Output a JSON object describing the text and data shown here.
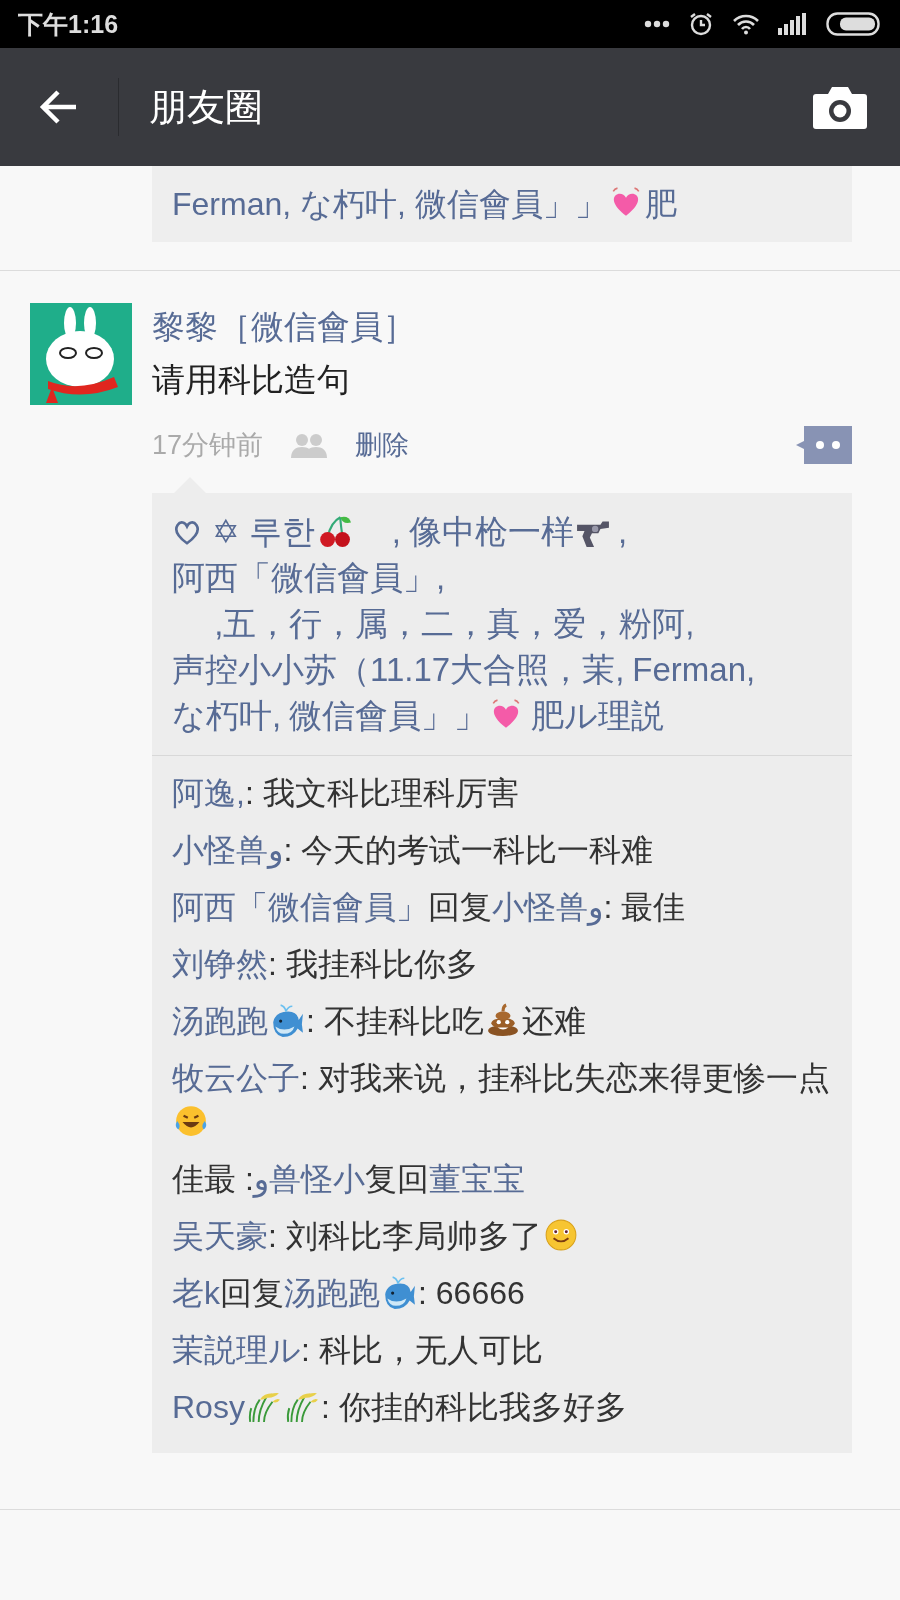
{
  "status_bar": {
    "time": "下午1:16"
  },
  "header": {
    "title": "朋友圈"
  },
  "previous_post": {
    "likes": [
      {
        "kind": "name",
        "text": "Ferman, な朽叶, 微信會員」」"
      },
      {
        "kind": "heart"
      },
      {
        "kind": "name",
        "text": "肥"
      }
    ]
  },
  "post": {
    "author": "黎黎［微信會員］",
    "text": "请用科比造句",
    "time": "17分钟前",
    "delete_label": "删除",
    "likes": [
      {
        "kind": "name",
        "text": "✡ 루한"
      },
      {
        "kind": "cherry"
      },
      {
        "kind": "name",
        "text": "　,"
      },
      {
        "kind": "name",
        "text": "像中枪一样"
      },
      {
        "kind": "revolver"
      },
      {
        "kind": "name",
        "text": ","
      },
      {
        "kind": "name",
        "text": "阿西「微信會員」,"
      },
      {
        "kind": "name",
        "text": "　 ,五，行，属，二，真，爱，粉阿,"
      },
      {
        "kind": "name",
        "text": "声控小小苏（11.17大合照，茉,"
      },
      {
        "kind": "name",
        "text": "Ferman,"
      },
      {
        "kind": "name",
        "text": "な朽叶,"
      },
      {
        "kind": "name",
        "text": "微信會員」」"
      },
      {
        "kind": "heart"
      },
      {
        "kind": "name",
        "text": "肥ル理説"
      }
    ],
    "comments": [
      {
        "parts": [
          {
            "kind": "name",
            "text": "阿逸,"
          },
          {
            "kind": "text",
            "text": ": 我文科比理科厉害"
          }
        ]
      },
      {
        "parts": [
          {
            "kind": "name",
            "text": "小怪兽و"
          },
          {
            "kind": "text",
            "text": ": 今天的考试一科比一科难"
          }
        ]
      },
      {
        "parts": [
          {
            "kind": "name",
            "text": "阿西「微信會員」"
          },
          {
            "kind": "text",
            "text": "回复"
          },
          {
            "kind": "name",
            "text": "小怪兽و"
          },
          {
            "kind": "text",
            "text": ": 最佳"
          }
        ]
      },
      {
        "parts": [
          {
            "kind": "name",
            "text": "刘铮然"
          },
          {
            "kind": "text",
            "text": ": 我挂科比你多"
          }
        ]
      },
      {
        "parts": [
          {
            "kind": "name",
            "text": "汤跑跑"
          },
          {
            "kind": "whale"
          },
          {
            "kind": "text",
            "text": ": 不挂科比吃"
          },
          {
            "kind": "poop"
          },
          {
            "kind": "text",
            "text": "还难"
          }
        ]
      },
      {
        "parts": [
          {
            "kind": "name",
            "text": "牧云公子"
          },
          {
            "kind": "text",
            "text": ": 对我来说，挂科比失恋来得更惨一点"
          },
          {
            "kind": "laugh"
          }
        ]
      },
      {
        "parts": [
          {
            "kind": "text",
            "text": "佳最 :"
          },
          {
            "kind": "name",
            "text": "و兽怪小"
          },
          {
            "kind": "text",
            "text": "复回"
          },
          {
            "kind": "name",
            "text": "董宝宝"
          }
        ]
      },
      {
        "parts": [
          {
            "kind": "name",
            "text": "吴天豪"
          },
          {
            "kind": "text",
            "text": ": 刘科比李局帅多了"
          },
          {
            "kind": "smile"
          }
        ]
      },
      {
        "parts": [
          {
            "kind": "name",
            "text": "老k"
          },
          {
            "kind": "text",
            "text": "回复"
          },
          {
            "kind": "name",
            "text": "汤跑跑"
          },
          {
            "kind": "whale"
          },
          {
            "kind": "text",
            "text": ": 66666"
          }
        ]
      },
      {
        "parts": [
          {
            "kind": "name",
            "text": "茉説理ル"
          },
          {
            "kind": "text",
            "text": ": 科比，无人可比"
          }
        ]
      },
      {
        "parts": [
          {
            "kind": "name",
            "text": "Rosy"
          },
          {
            "kind": "grass"
          },
          {
            "kind": "grass"
          },
          {
            "kind": "text",
            "text": ": 你挂的科比我多好多"
          }
        ]
      }
    ]
  }
}
